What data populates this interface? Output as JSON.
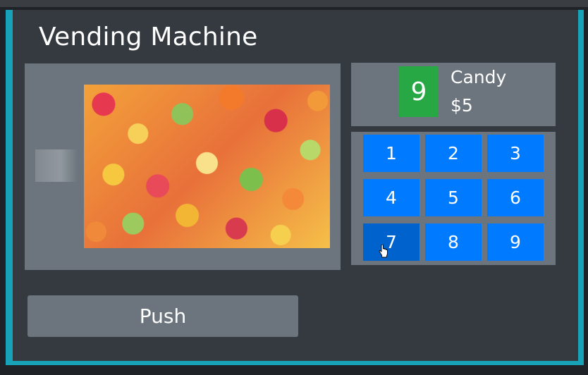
{
  "app": {
    "title": "Vending Machine"
  },
  "display": {
    "image_icon": "candy-photo",
    "thumbnail_icon": "faded-thumbnail"
  },
  "info": {
    "selected_number": "9",
    "product_name": "Candy",
    "product_price": "$5"
  },
  "keypad": {
    "keys": [
      "1",
      "2",
      "3",
      "4",
      "5",
      "6",
      "7",
      "8",
      "9"
    ],
    "active_key": "7"
  },
  "actions": {
    "push_label": "Push"
  },
  "colors": {
    "frame_accent": "#17a2b8",
    "panel": "#6c757d",
    "machine_bg": "#343a40",
    "badge": "#28a745",
    "key": "#007bff"
  }
}
